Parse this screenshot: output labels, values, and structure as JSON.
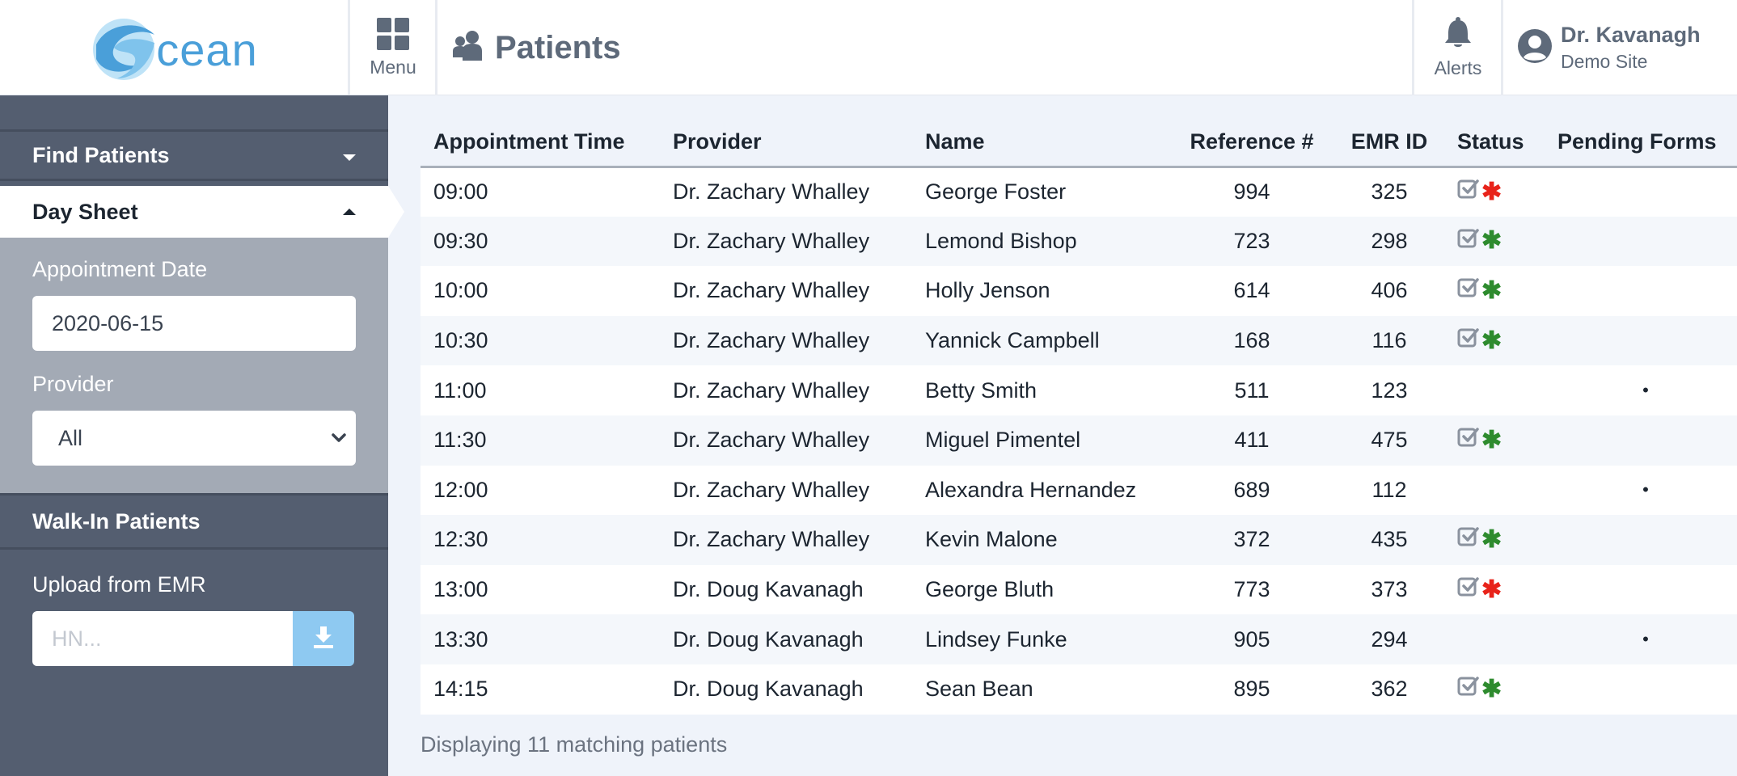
{
  "header": {
    "logo_text": "cean",
    "menu_label": "Menu",
    "page_title": "Patients",
    "alerts_label": "Alerts",
    "user_name": "Dr. Kavanagh",
    "user_site": "Demo Site"
  },
  "sidebar": {
    "find_patients": "Find Patients",
    "day_sheet": "Day Sheet",
    "appointment_date_label": "Appointment Date",
    "appointment_date_value": "2020-06-15",
    "provider_label": "Provider",
    "provider_value": "All",
    "walkin_patients": "Walk-In Patients",
    "upload_label": "Upload from EMR",
    "hn_placeholder": "HN..."
  },
  "table": {
    "columns": [
      "Appointment Time",
      "Provider",
      "Name",
      "Reference #",
      "EMR ID",
      "Status",
      "Pending Forms"
    ],
    "rows": [
      {
        "time": "09:00",
        "provider": "Dr. Zachary Whalley",
        "name": "George Foster",
        "ref": "994",
        "emr": "325",
        "status": "red",
        "pending": ""
      },
      {
        "time": "09:30",
        "provider": "Dr. Zachary Whalley",
        "name": "Lemond Bishop",
        "ref": "723",
        "emr": "298",
        "status": "green",
        "pending": ""
      },
      {
        "time": "10:00",
        "provider": "Dr. Zachary Whalley",
        "name": "Holly Jenson",
        "ref": "614",
        "emr": "406",
        "status": "green",
        "pending": ""
      },
      {
        "time": "10:30",
        "provider": "Dr. Zachary Whalley",
        "name": "Yannick Campbell",
        "ref": "168",
        "emr": "116",
        "status": "green",
        "pending": ""
      },
      {
        "time": "11:00",
        "provider": "Dr. Zachary Whalley",
        "name": "Betty Smith",
        "ref": "511",
        "emr": "123",
        "status": "",
        "pending": "•"
      },
      {
        "time": "11:30",
        "provider": "Dr. Zachary Whalley",
        "name": "Miguel Pimentel",
        "ref": "411",
        "emr": "475",
        "status": "green",
        "pending": ""
      },
      {
        "time": "12:00",
        "provider": "Dr. Zachary Whalley",
        "name": "Alexandra Hernandez",
        "ref": "689",
        "emr": "112",
        "status": "",
        "pending": "•"
      },
      {
        "time": "12:30",
        "provider": "Dr. Zachary Whalley",
        "name": "Kevin Malone",
        "ref": "372",
        "emr": "435",
        "status": "green",
        "pending": ""
      },
      {
        "time": "13:00",
        "provider": "Dr. Doug Kavanagh",
        "name": "George Bluth",
        "ref": "773",
        "emr": "373",
        "status": "red",
        "pending": ""
      },
      {
        "time": "13:30",
        "provider": "Dr. Doug Kavanagh",
        "name": "Lindsey Funke",
        "ref": "905",
        "emr": "294",
        "status": "",
        "pending": "•"
      },
      {
        "time": "14:15",
        "provider": "Dr. Doug Kavanagh",
        "name": "Sean Bean",
        "ref": "895",
        "emr": "362",
        "status": "green",
        "pending": ""
      }
    ]
  },
  "footer": {
    "count_text": "Displaying 11 matching patients"
  },
  "colors": {
    "status_red": "#e8231a",
    "status_green": "#2e8b2e",
    "accent": "#4a9fd9",
    "sidebar_bg": "#545e70"
  },
  "icons": {
    "status_check": "check-square-icon",
    "status_star": "asterisk-icon"
  }
}
